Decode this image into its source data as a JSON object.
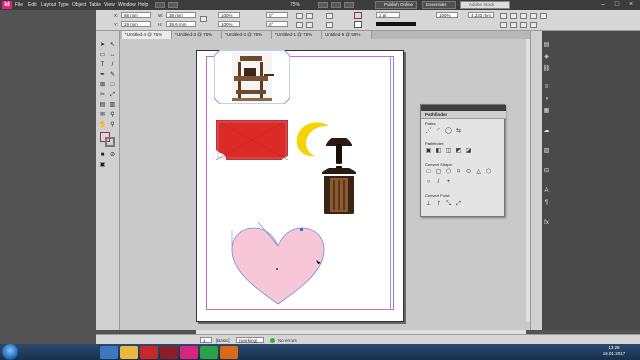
{
  "app": {
    "logo": "Id"
  },
  "menu": [
    "File",
    "Edit",
    "Layout",
    "Type",
    "Object",
    "Table",
    "View",
    "Window",
    "Help"
  ],
  "zoom_top": "75%",
  "publish": "Publish Online",
  "workspace": "Essentials",
  "search_placeholder": "Adobe Stock",
  "control": {
    "x": "88 mm",
    "y": "29 mm",
    "w": "38 mm",
    "h": "39.6 mm",
    "scale_x": "100%",
    "scale_y": "100%",
    "rotate": "0°",
    "shear": "0°",
    "stroke_weight": "1 pt",
    "width_field": "4.233 mm",
    "pct": "100%"
  },
  "tabs": [
    "*Untitled-4 @ 75%",
    "*Untitled-3 @ 75%",
    "*Untitled-2 @ 75%",
    "*Untitled-1 @ 75%",
    "Untitled-5 @ 59%"
  ],
  "pathfinder": {
    "title": "Pathfinder",
    "paths_label": "Paths:",
    "pathfinder_label": "Pathfinder:",
    "convert_shape_label": "Convert Shape:",
    "convert_point_label": "Convert Point:"
  },
  "status": {
    "zoom": "[Basic]",
    "page_field": "(working)",
    "errors": "No errors"
  },
  "clock": {
    "time": "13:28",
    "date": "16.01.2017"
  },
  "colors": {
    "red_rect": "#dc2b26",
    "heart": "#f7c7d8",
    "moon": "#f6d305",
    "accent": "#d9267c"
  },
  "icons": {
    "lock": "lock-icon",
    "selection": "selection-tool-icon"
  }
}
